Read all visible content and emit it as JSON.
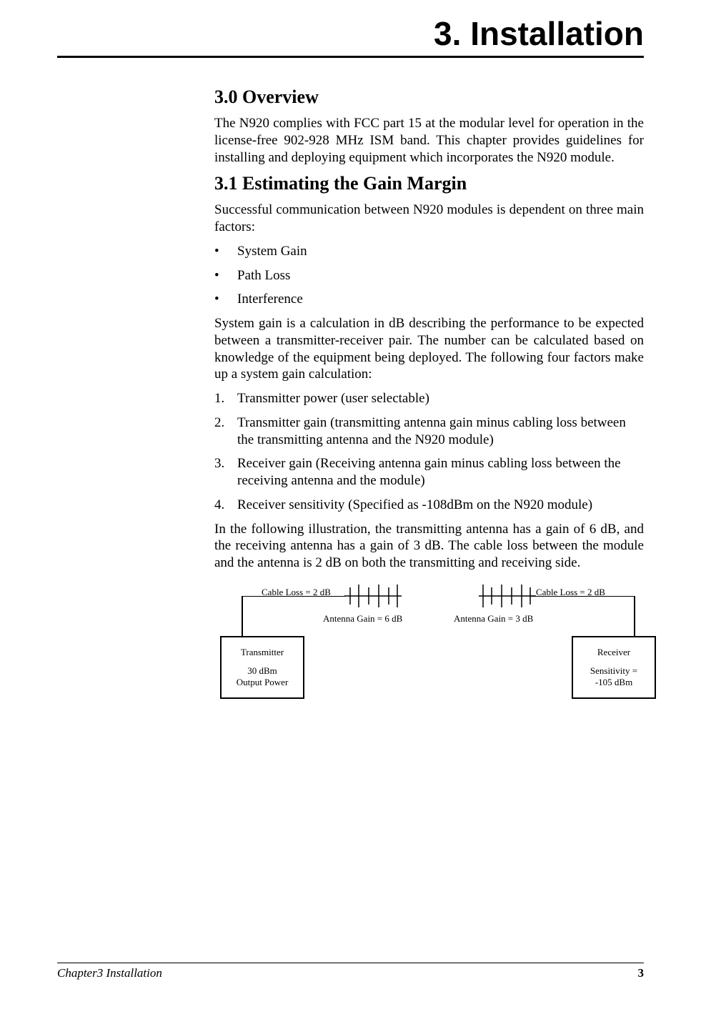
{
  "chapter_title": "3.  Installation",
  "sections": {
    "s30": {
      "heading": "3.0   Overview",
      "para1": "The N920 complies with FCC part 15 at the modular level for operation in the license-free 902-928 MHz ISM band.  This chapter provides guidelines for installing and deploying equipment which incorporates the N920 module."
    },
    "s31": {
      "heading": "3.1   Estimating the Gain Margin",
      "para1": "Successful communication between N920 modules is dependent on three main factors:",
      "bullets": [
        "System Gain",
        "Path Loss",
        "Interference"
      ],
      "para2": "System gain is a calculation in dB describing the performance to be expected between a transmitter-receiver pair.  The number can be calculated based on knowledge of the equipment being deployed.  The following four factors make up a system gain calculation:",
      "numbered": [
        "Transmitter power (user selectable)",
        "Transmitter gain (transmitting antenna gain minus cabling loss between the transmitting antenna and the N920 module)",
        "Receiver gain (Receiving antenna gain minus cabling loss between the receiving antenna and the module)",
        "Receiver sensitivity (Specified as -108dBm on the N920 module)"
      ],
      "para3": "In the following illustration, the transmitting antenna has a gain of 6 dB, and the receiving antenna has a gain of 3 dB.  The cable loss between the module and the antenna is 2 dB on both the transmitting and receiving side."
    }
  },
  "diagram": {
    "tx_title": "Transmitter",
    "tx_sub1": "30 dBm",
    "tx_sub2": "Output Power",
    "rx_title": "Receiver",
    "rx_sub1": "Sensitivity =",
    "rx_sub2": "-105 dBm",
    "cable_left": "Cable Loss = 2 dB",
    "cable_right": "Cable Loss = 2 dB",
    "gain_left": "Antenna Gain = 6 dB",
    "gain_right": "Antenna Gain = 3 dB"
  },
  "footer": {
    "left": "Chapter3 Installation",
    "right": "3"
  }
}
